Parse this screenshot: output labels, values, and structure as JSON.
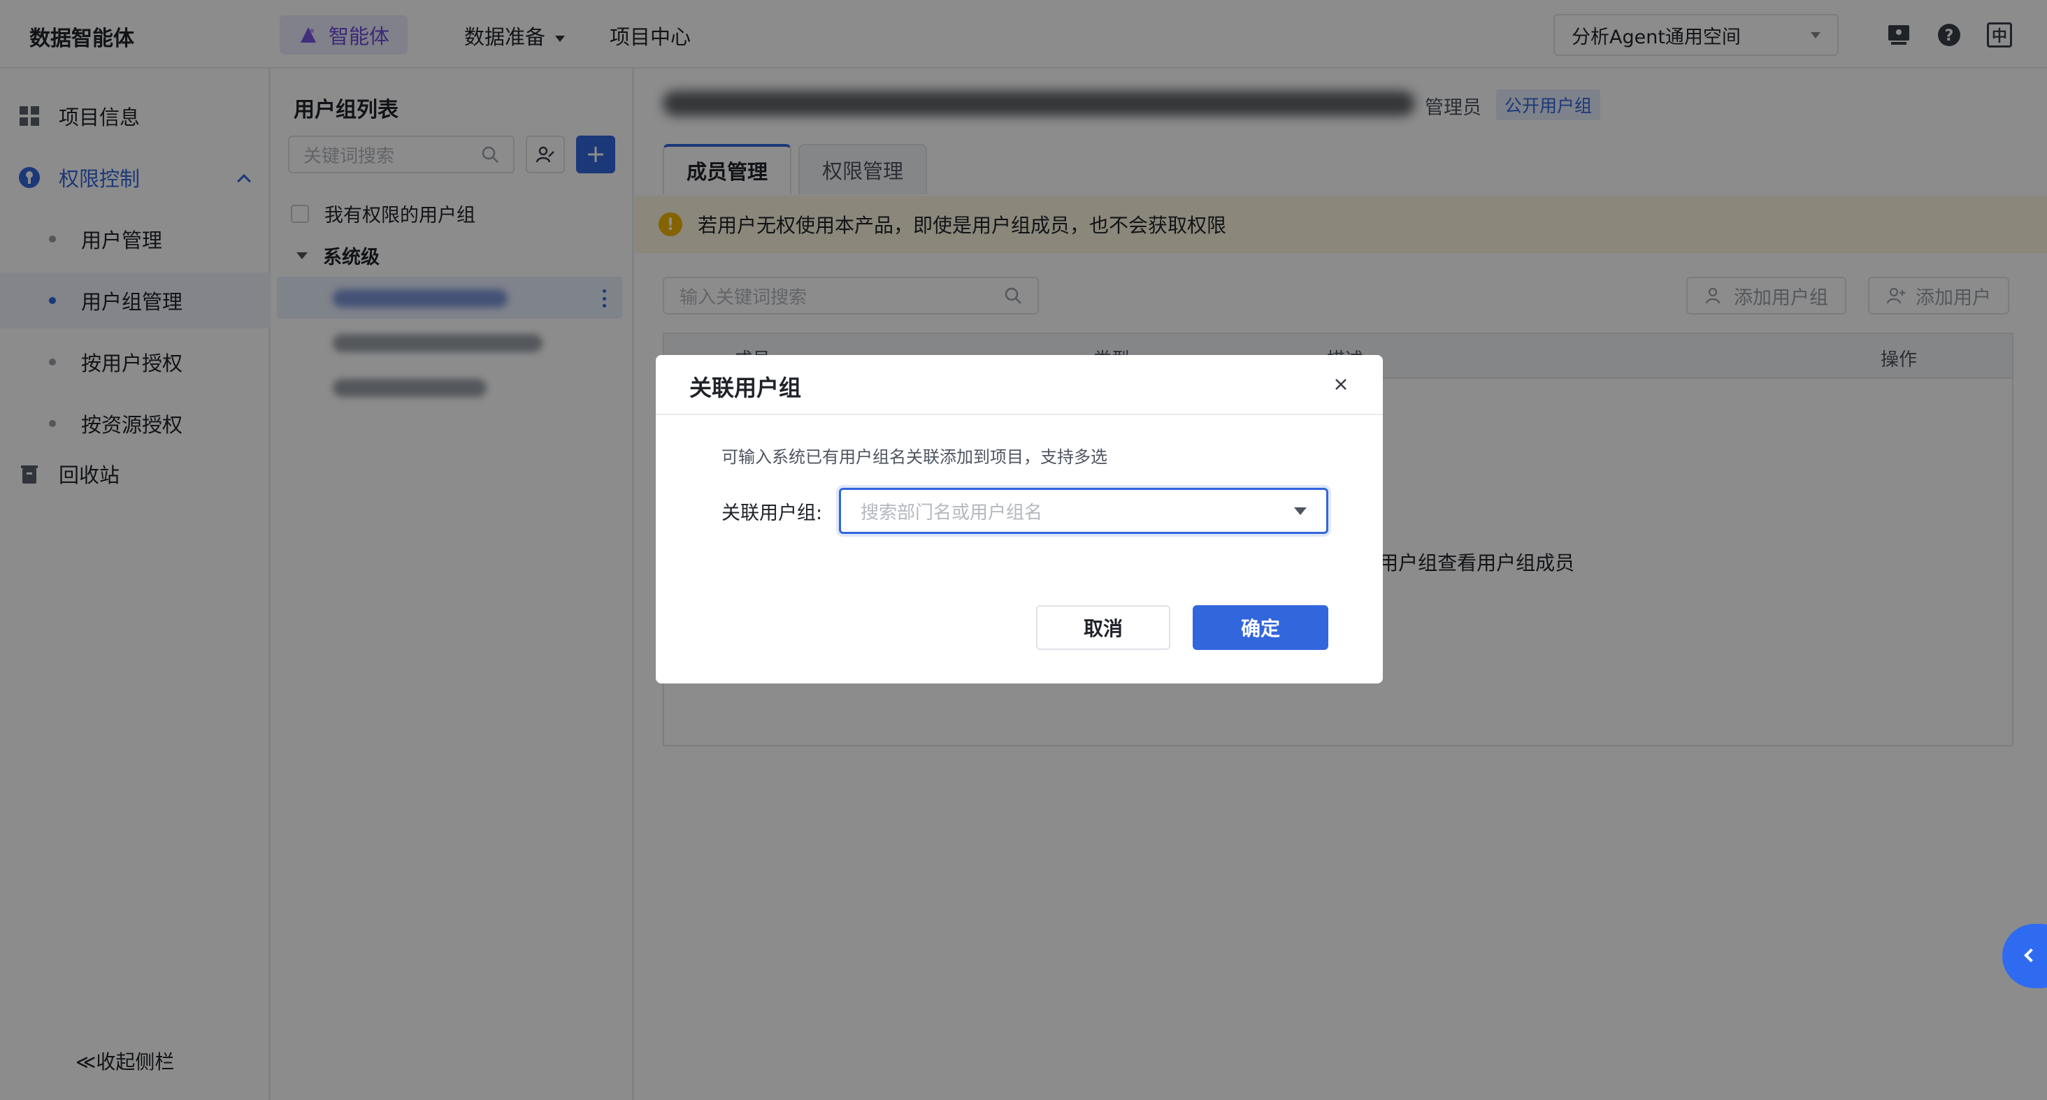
{
  "header": {
    "brand": "数据智能体",
    "nav": {
      "agent": "智能体",
      "data_prep": "数据准备",
      "project_center": "项目中心"
    },
    "space": "分析Agent通用空间",
    "icons": [
      "monitor-icon",
      "help-icon",
      "language-icon"
    ],
    "language_badge": "中"
  },
  "sidebar": {
    "project_info": "项目信息",
    "permission": "权限控制",
    "user_mgmt": "用户管理",
    "group_mgmt": "用户组管理",
    "by_user": "按用户授权",
    "by_resource": "按资源授权",
    "recycle": "回收站",
    "collapse": "≪收起侧栏"
  },
  "group_panel": {
    "title": "用户组列表",
    "search_placeholder": "关键词搜索",
    "my_groups": "我有权限的用户组",
    "level": "系统级"
  },
  "main": {
    "admin_label": "管理员",
    "public_tag": "公开用户组",
    "tabs": [
      "成员管理",
      "权限管理"
    ],
    "warning": "若用户无权使用本产品，即使是用户组成员，也不会获取权限",
    "search_placeholder": "输入关键词搜索",
    "add_group": "添加用户组",
    "add_user": "添加用户",
    "columns": [
      "成员",
      "类型",
      "描述",
      "操作"
    ],
    "empty_hint": "-用户组查看用户组成员"
  },
  "dialog": {
    "title": "关联用户组",
    "hint": "可输入系统已有用户组名关联添加到项目，支持多选",
    "field_label": "关联用户组:",
    "select_placeholder": "搜索部门名或用户组名",
    "cancel": "取消",
    "ok": "确定"
  },
  "colors": {
    "primary": "#3266dd",
    "agent_purple": "#6f4bd8",
    "warning_bg": "#fdf6e1",
    "warning_icon": "#f0b400"
  }
}
